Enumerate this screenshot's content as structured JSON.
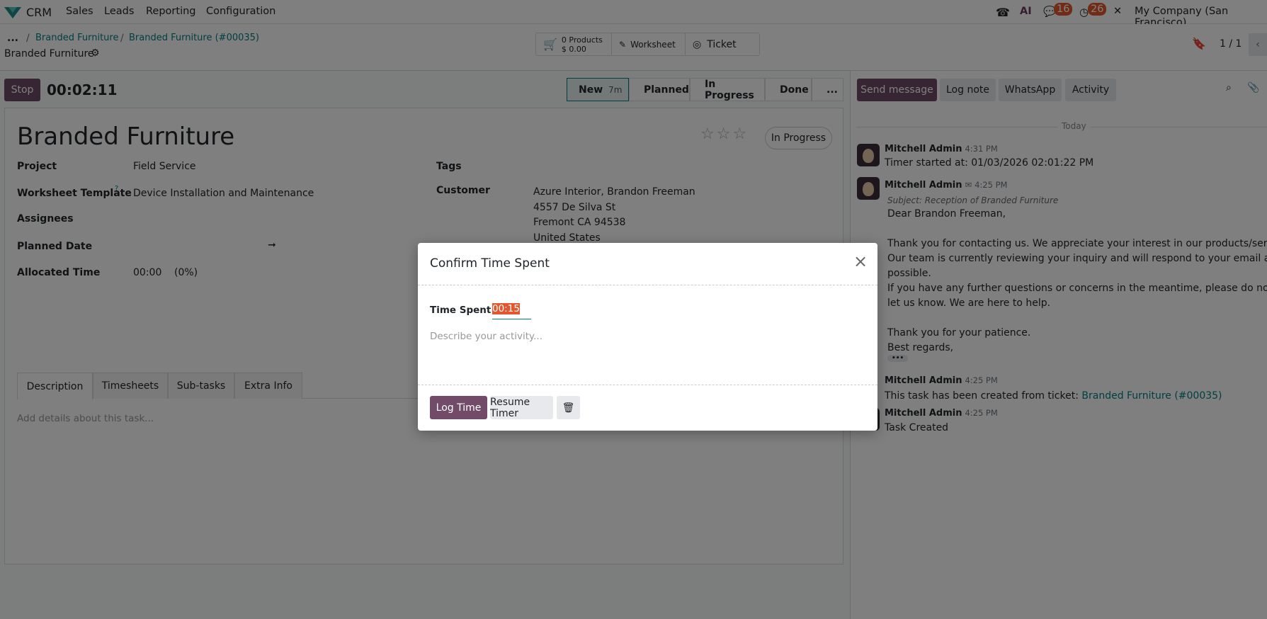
{
  "navbar": {
    "app": "CRM",
    "menu": [
      "Sales",
      "Leads",
      "Reporting",
      "Configuration"
    ],
    "messages_count": "16",
    "activities_count": "26",
    "company": "My Company (San Francisco)"
  },
  "breadcrumb": {
    "ellipsis": "...",
    "items": [
      "Branded Furniture",
      "Branded Furniture (#00035)"
    ],
    "current": "Branded Furniture"
  },
  "smart_buttons": {
    "products_count": "0 Products",
    "products_amount": "$ 0.00",
    "worksheet": "Worksheet",
    "ticket": "Ticket"
  },
  "pager": "1 / 1",
  "timer": {
    "stop_label": "Stop",
    "elapsed": "00:02:11"
  },
  "stages": [
    {
      "label": "New",
      "duration": "7m",
      "active": true
    },
    {
      "label": "Planned"
    },
    {
      "label": "In Progress"
    },
    {
      "label": "Done"
    },
    {
      "label": "..."
    }
  ],
  "task": {
    "title": "Branded Furniture",
    "state": "In Progress",
    "fields": {
      "project_label": "Project",
      "project": "Field Service",
      "worksheet_label": "Worksheet Template",
      "worksheet_help": "?",
      "worksheet": "Device Installation and Maintenance",
      "assignees_label": "Assignees",
      "planned_label": "Planned Date",
      "planned_arrow": "➞",
      "allocated_label": "Allocated Time",
      "allocated": "00:00",
      "allocated_pct": "(0%)",
      "tags_label": "Tags",
      "customer_label": "Customer",
      "customer": [
        "Azure Interior, Brandon Freeman",
        "4557 De Silva St",
        "Fremont CA 94538",
        "United States"
      ]
    },
    "tabs": [
      "Description",
      "Timesheets",
      "Sub-tasks",
      "Extra Info"
    ],
    "description_placeholder": "Add details about this task..."
  },
  "chatter": {
    "buttons": [
      "Send message",
      "Log note",
      "WhatsApp",
      "Activity"
    ],
    "date_separator": "Today",
    "messages": [
      {
        "author": "Mitchell Admin",
        "time": "4:31 PM",
        "body": "Timer started at: 01/03/2026 02:01:22 PM"
      },
      {
        "author": "Mitchell Admin",
        "time": "4:25 PM",
        "subject": "Subject: Reception of Branded Furniture",
        "lines": [
          "Dear Brandon Freeman,",
          "",
          "Thank you for contacting us. We appreciate your interest in our products/services.",
          "Our team is currently reviewing your inquiry and will respond to your email as soon as",
          "possible.",
          "If you have any further questions or concerns in the meantime, please do not hesitate to",
          "let us know. We are here to help.",
          "",
          "Thank you for your patience.",
          "Best regards,"
        ],
        "more": "•••"
      },
      {
        "author": "Mitchell Admin",
        "time": "4:25 PM",
        "body": "This task has been created from ticket: ",
        "link": "Branded Furniture (#00035)"
      },
      {
        "author": "Mitchell Admin",
        "time": "4:25 PM",
        "body": "Task Created"
      }
    ]
  },
  "dialog": {
    "title": "Confirm Time Spent",
    "time_label": "Time Spent",
    "time_value": "00:15",
    "description_placeholder": "Describe your activity...",
    "log_time": "Log Time",
    "resume_timer": "Resume Timer"
  },
  "colors": {
    "primary": "#714b67",
    "link": "#017e84",
    "badge": "#e4572e"
  }
}
